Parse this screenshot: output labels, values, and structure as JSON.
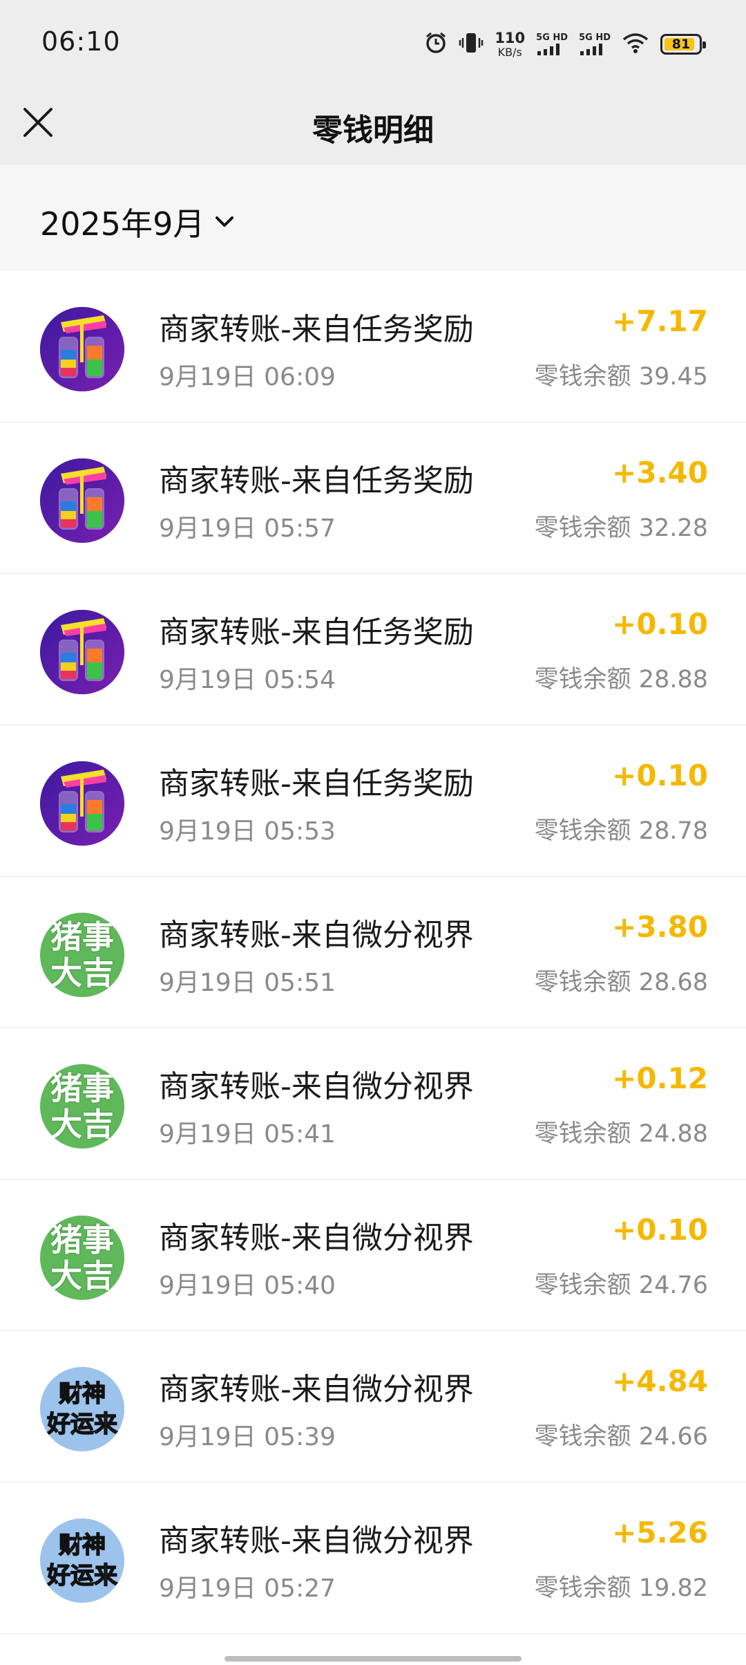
{
  "status_bar": {
    "time": "06:10",
    "net_speed_value": "110",
    "net_speed_unit": "KB/s",
    "sim1_label": "5G HD",
    "sim2_label": "5G HD",
    "battery": "81"
  },
  "nav": {
    "title": "零钱明细"
  },
  "filter": {
    "month": "2025年9月"
  },
  "colors": {
    "amount": "#f5b800",
    "secondary_text": "#8a8a8a"
  },
  "transactions": [
    {
      "title": "商家转账-来自任务奖励",
      "time": "9月19日 06:09",
      "amount": "+7.17",
      "balance": "零钱余额 39.45",
      "avatar": "bottles"
    },
    {
      "title": "商家转账-来自任务奖励",
      "time": "9月19日 05:57",
      "amount": "+3.40",
      "balance": "零钱余额 32.28",
      "avatar": "bottles"
    },
    {
      "title": "商家转账-来自任务奖励",
      "time": "9月19日 05:54",
      "amount": "+0.10",
      "balance": "零钱余额 28.88",
      "avatar": "bottles"
    },
    {
      "title": "商家转账-来自任务奖励",
      "time": "9月19日 05:53",
      "amount": "+0.10",
      "balance": "零钱余额 28.78",
      "avatar": "bottles"
    },
    {
      "title": "商家转账-来自微分视界",
      "time": "9月19日 05:51",
      "amount": "+3.80",
      "balance": "零钱余额 28.68",
      "avatar": "green",
      "avatar_text": [
        "猪事",
        "大吉"
      ]
    },
    {
      "title": "商家转账-来自微分视界",
      "time": "9月19日 05:41",
      "amount": "+0.12",
      "balance": "零钱余额 24.88",
      "avatar": "green",
      "avatar_text": [
        "猪事",
        "大吉"
      ]
    },
    {
      "title": "商家转账-来自微分视界",
      "time": "9月19日 05:40",
      "amount": "+0.10",
      "balance": "零钱余额 24.76",
      "avatar": "green",
      "avatar_text": [
        "猪事",
        "大吉"
      ]
    },
    {
      "title": "商家转账-来自微分视界",
      "time": "9月19日 05:39",
      "amount": "+4.84",
      "balance": "零钱余额 24.66",
      "avatar": "blue",
      "avatar_text": [
        "财神",
        "好运来"
      ]
    },
    {
      "title": "商家转账-来自微分视界",
      "time": "9月19日 05:27",
      "amount": "+5.26",
      "balance": "零钱余额 19.82",
      "avatar": "blue",
      "avatar_text": [
        "财神",
        "好运来"
      ]
    }
  ]
}
